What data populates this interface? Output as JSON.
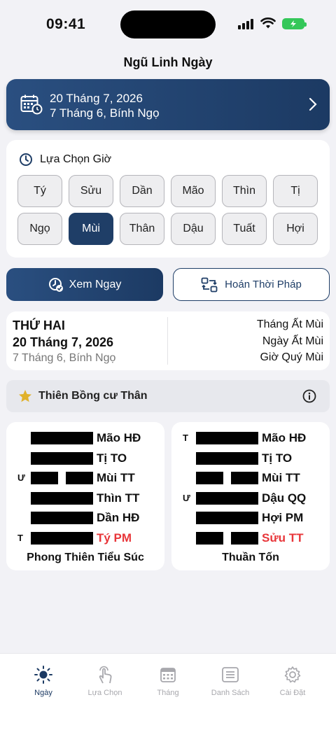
{
  "status_bar": {
    "time": "09:41"
  },
  "header": {
    "title": "Ngũ Linh Ngày"
  },
  "date_card": {
    "solar": "20 Tháng 7, 2026",
    "lunar": "7 Tháng 6, Bính Ngọ"
  },
  "hour_picker": {
    "title": "Lựa Chọn Giờ",
    "hours": [
      "Tý",
      "Sửu",
      "Dần",
      "Mão",
      "Thìn",
      "Tị",
      "Ngọ",
      "Mùi",
      "Thân",
      "Dậu",
      "Tuất",
      "Hợi"
    ],
    "selected": "Mùi"
  },
  "actions": {
    "view_day": "Xem Ngay",
    "swap_method": "Hoán Thời Pháp"
  },
  "day_info": {
    "weekday": "THỨ HAI",
    "solar": "20 Tháng 7, 2026",
    "lunar": "7 Tháng 6, Bính Ngọ",
    "month": "Tháng Ất Mùi",
    "day": "Ngày Ất Mùi",
    "hour": "Giờ Quý Mùi"
  },
  "star_section": {
    "title": "Thiên Bồng cư Thân"
  },
  "hexagrams": [
    {
      "name": "Phong Thiên Tiểu Súc",
      "lines": [
        {
          "marker": "",
          "type": "yang",
          "label": "Mão HĐ",
          "highlight": false
        },
        {
          "marker": "",
          "type": "yang",
          "label": "Tị TO",
          "highlight": false
        },
        {
          "marker": "Ư",
          "type": "yin",
          "label": "Mùi TT",
          "highlight": false
        },
        {
          "marker": "",
          "type": "yang",
          "label": "Thìn TT",
          "highlight": false
        },
        {
          "marker": "",
          "type": "yang",
          "label": "Dần HĐ",
          "highlight": false
        },
        {
          "marker": "T",
          "type": "yang",
          "label": "Tý PM",
          "highlight": true
        }
      ]
    },
    {
      "name": "Thuần Tốn",
      "lines": [
        {
          "marker": "T",
          "type": "yang",
          "label": "Mão HĐ",
          "highlight": false
        },
        {
          "marker": "",
          "type": "yang",
          "label": "Tị TO",
          "highlight": false
        },
        {
          "marker": "",
          "type": "yin",
          "label": "Mùi TT",
          "highlight": false
        },
        {
          "marker": "Ư",
          "type": "yang",
          "label": "Dậu QQ",
          "highlight": false
        },
        {
          "marker": "",
          "type": "yang",
          "label": "Hợi PM",
          "highlight": false
        },
        {
          "marker": "",
          "type": "yin",
          "label": "Sửu TT",
          "highlight": true
        }
      ]
    }
  ],
  "tab_bar": {
    "tabs": [
      {
        "label": "Ngày",
        "icon": "sun-icon",
        "active": true
      },
      {
        "label": "Lựa Chọn",
        "icon": "tap-hand-icon",
        "active": false
      },
      {
        "label": "Tháng",
        "icon": "calendar-grid-icon",
        "active": false
      },
      {
        "label": "Danh Sách",
        "icon": "list-icon",
        "active": false
      },
      {
        "label": "Cài Đặt",
        "icon": "gear-icon",
        "active": false
      }
    ]
  },
  "colors": {
    "primary": "#1c3a63",
    "accent_red": "#e8363a",
    "star": "#e0b12b",
    "battery": "#34c759"
  }
}
